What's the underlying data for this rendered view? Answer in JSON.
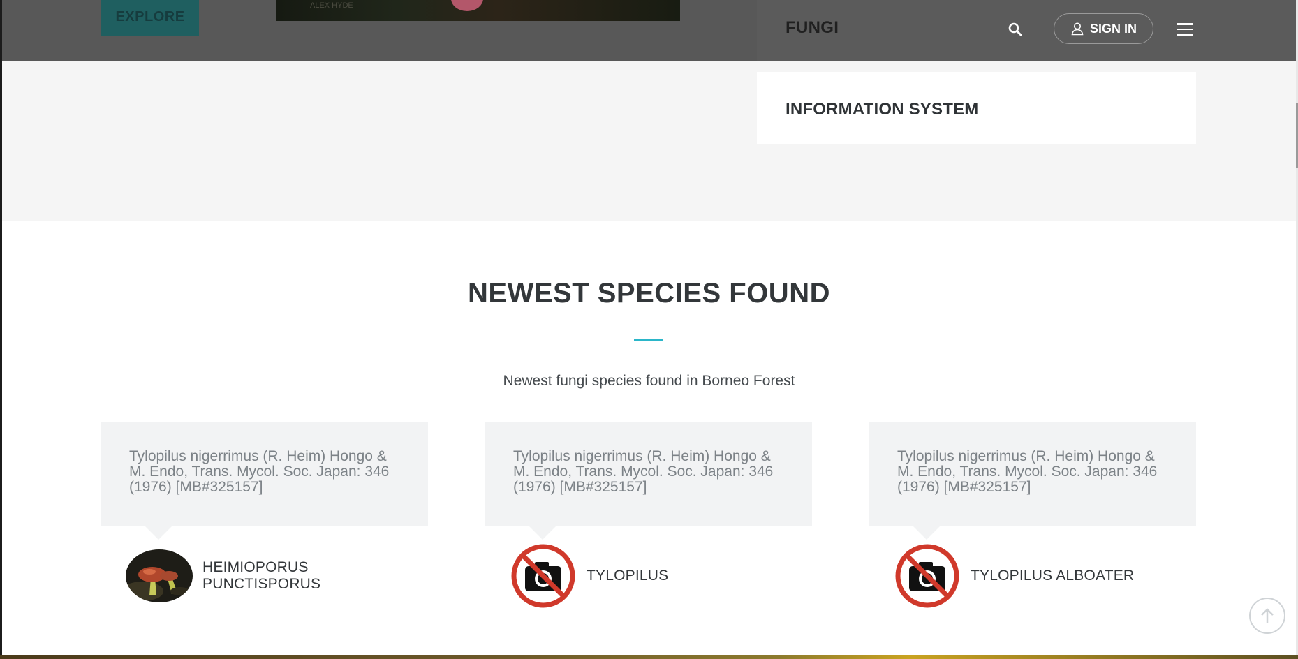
{
  "hero": {
    "explore_label": "EXPLORE",
    "photo_watermark": "ALEX HYDE"
  },
  "header": {
    "brand": "FUNGI",
    "search_icon": "search-icon",
    "signin_label": "SIGN IN",
    "user_icon": "user-icon",
    "menu_icon": "hamburger-menu-icon"
  },
  "info_card": {
    "title": "INFORMATION SYSTEM"
  },
  "section": {
    "title": "NEWEST SPECIES FOUND",
    "subtitle": "Newest fungi species found in Borneo Forest",
    "accent_color": "#2bb6c9"
  },
  "species": [
    {
      "quote": "Tylopilus nigerrimus (R. Heim) Hongo & M. Endo, Trans. Mycol. Soc. Japan: 346 (1976) [MB#325157]",
      "name": "HEIMIOPORUS PUNCTISPORUS",
      "image": "mushroom-photo"
    },
    {
      "quote": "Tylopilus nigerrimus (R. Heim) Hongo & M. Endo, Trans. Mycol. Soc. Japan: 346 (1976) [MB#325157]",
      "name": "TYLOPILUS",
      "image": "no-photo-icon"
    },
    {
      "quote": "Tylopilus nigerrimus (R. Heim) Hongo & M. Endo, Trans. Mycol. Soc. Japan: 346 (1976) [MB#325157]",
      "name": "TYLOPILUS ALBOATER",
      "image": "no-photo-icon"
    }
  ],
  "scroll_top_icon": "arrow-up-circle-icon"
}
